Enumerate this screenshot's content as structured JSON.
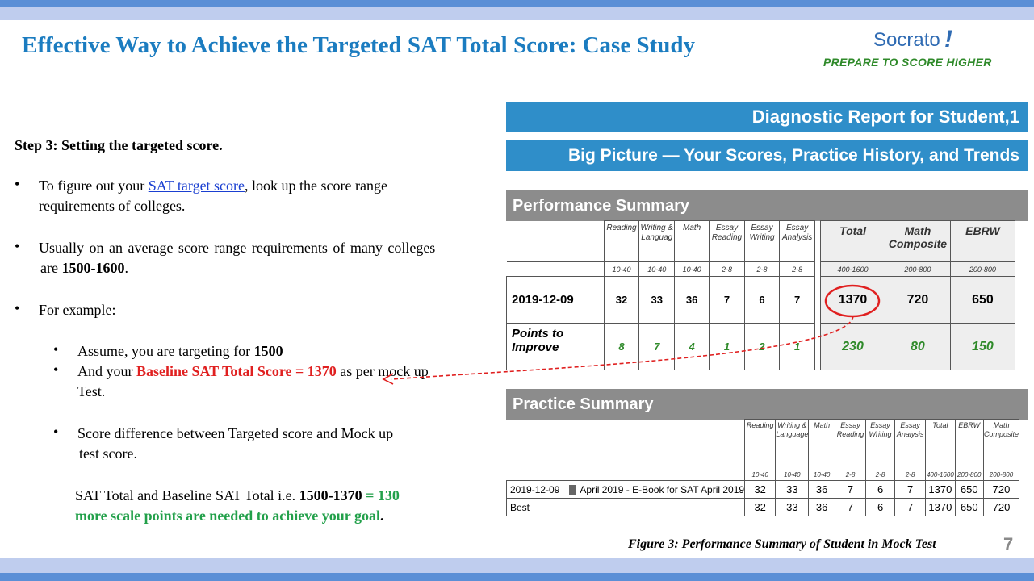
{
  "title": "Effective Way to Achieve the Targeted SAT Total Score: Case Study",
  "logo": {
    "word": "Socrato",
    "mark": "!",
    "tagline": "PREPARE TO SCORE HIGHER"
  },
  "left": {
    "step_heading": "Step 3: Setting the targeted score.",
    "b1_pre": "To figure out your ",
    "b1_link": "SAT target score",
    "b1_post": ", look up the score range",
    "b1_line2": "requirements of colleges.",
    "b2_line1": "Usually on an average score range requirements of many colleges",
    "b2_line2_pre": "are ",
    "b2_line2_bold": "1500-1600",
    "b2_line2_post": ".",
    "b3": "For example:",
    "s1_pre": "Assume, you are targeting for ",
    "s1_bold": "1500",
    "s2_pre": "And your ",
    "s2_red": "Baseline SAT Total Score = 1370",
    "s2_post": " as per mock up",
    "s2_line2": "Test.",
    "s3_line1": "Score difference between  Targeted score and Mock up",
    "s3_line2": "test score.",
    "res_pre": "SAT Total and Baseline SAT Total i.e. ",
    "res_bold": "1500-1370",
    "res_eq": " = 130",
    "res_line2": "more scale points  are needed to achieve your goal",
    "res_dot": "."
  },
  "report": {
    "header1": "Diagnostic Report for  Student,1",
    "header2": "Big Picture — Your Scores, Practice History, and Trends",
    "performance_title": "Performance Summary",
    "columns": [
      "Reading",
      "Writing & Languag",
      "Math",
      "Essay Reading",
      "Essay Writing",
      "Essay Analysis"
    ],
    "ranges": [
      "10-40",
      "10-40",
      "10-40",
      "2-8",
      "2-8",
      "2-8"
    ],
    "big_columns": [
      "Total",
      "Math Composite",
      "EBRW"
    ],
    "big_ranges": [
      "400-1600",
      "200-800",
      "200-800"
    ],
    "row1_label": "2019-12-09",
    "row1_values": [
      "32",
      "33",
      "36",
      "7",
      "6",
      "7"
    ],
    "row1_big": [
      "1370",
      "720",
      "650"
    ],
    "row2_label": "Points to Improve",
    "row2_values": [
      "8",
      "7",
      "4",
      "1",
      "2",
      "1"
    ],
    "row2_big": [
      "230",
      "80",
      "150"
    ]
  },
  "practice": {
    "title": "Practice Summary",
    "columns": [
      "Reading",
      "Writing & Language",
      "Math",
      "Essay Reading",
      "Essay Writing",
      "Essay Analysis",
      "Total",
      "EBRW",
      "Math Composite"
    ],
    "ranges": [
      "10-40",
      "10-40",
      "10-40",
      "2-8",
      "2-8",
      "2-8",
      "400-1600",
      "200-800",
      "200-800"
    ],
    "row1_date": "2019-12-09",
    "row1_test": "April 2019 - E-Book for SAT April 2019",
    "row1_values": [
      "32",
      "33",
      "36",
      "7",
      "6",
      "7",
      "1370",
      "650",
      "720"
    ],
    "row2_label": "Best",
    "row2_values": [
      "32",
      "33",
      "36",
      "7",
      "6",
      "7",
      "1370",
      "650",
      "720"
    ]
  },
  "caption": "Figure 3: Performance Summary of Student in Mock Test",
  "page_number": "7",
  "colors": {
    "title_blue": "#1b7cc0",
    "report_blue": "#2f8ec9",
    "highlight_red": "#e02020",
    "result_green": "#22a04a"
  }
}
